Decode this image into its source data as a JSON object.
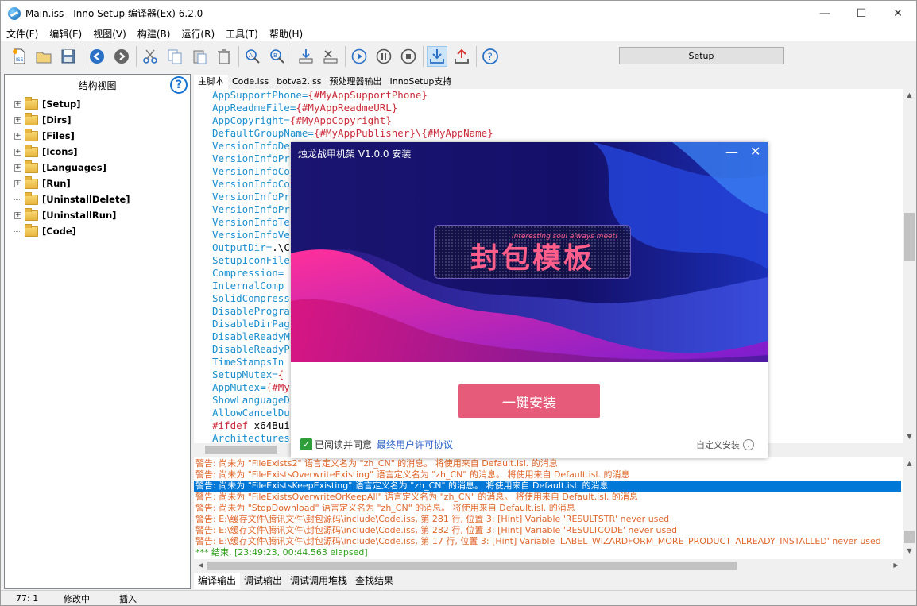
{
  "window": {
    "title": "Main.iss - Inno Setup 编译器(Ex) 6.2.0",
    "min": "—",
    "max": "☐",
    "close": "✕"
  },
  "menu": [
    "文件(F)",
    "编辑(E)",
    "视图(V)",
    "构建(B)",
    "运行(R)",
    "工具(T)",
    "帮助(H)"
  ],
  "toolbar": {
    "setup_label": "Setup"
  },
  "tree": {
    "header": "结构视图",
    "help": "?",
    "items": [
      {
        "label": "[Setup]",
        "expand": "+"
      },
      {
        "label": "[Dirs]",
        "expand": "+"
      },
      {
        "label": "[Files]",
        "expand": "+"
      },
      {
        "label": "[Icons]",
        "expand": "+"
      },
      {
        "label": "[Languages]",
        "expand": "+"
      },
      {
        "label": "[Run]",
        "expand": "+"
      },
      {
        "label": "[UninstallDelete]",
        "expand": ""
      },
      {
        "label": "[UninstallRun]",
        "expand": "+"
      },
      {
        "label": "[Code]",
        "expand": ""
      }
    ]
  },
  "editor_tabs": [
    "主脚本",
    "Code.iss",
    "botva2.iss",
    "预处理器输出",
    "InnoSetup支持"
  ],
  "code": [
    {
      "k": "AppSupportPhone=",
      "v": "{#MyAppSupportPhone}"
    },
    {
      "k": "AppReadmeFile=",
      "v": "{#MyAppReadmeURL}"
    },
    {
      "k": "AppCopyright=",
      "v": "{#MyAppCopyright}"
    },
    {
      "k": "DefaultGroupName=",
      "v": "{#MyAppPublisher}\\{#MyAppName}"
    },
    {
      "k": "VersionInfoDe",
      "v": ""
    },
    {
      "k": "VersionInfoPr",
      "v": ""
    },
    {
      "k": "VersionInfoCo",
      "v": ""
    },
    {
      "k": "VersionInfoCo",
      "v": ""
    },
    {
      "k": "VersionInfoPr",
      "v": ""
    },
    {
      "k": "VersionInfoPr",
      "v": ""
    },
    {
      "k": "VersionInfoTe",
      "v": ""
    },
    {
      "k": "VersionInfoVe",
      "v": ""
    },
    {
      "k": "OutputDir=",
      "v": ".\\C"
    },
    {
      "k": "SetupIconFile",
      "v": ""
    },
    {
      "k": "Compression=",
      "v": ""
    },
    {
      "k": "InternalComp",
      "v": ""
    },
    {
      "k": "SolidCompress",
      "v": ""
    },
    {
      "k": "DisableProgra",
      "v": ""
    },
    {
      "k": "DisableDirPag",
      "v": ""
    },
    {
      "k": "DisableReadyM",
      "v": ""
    },
    {
      "k": "DisableReadyP",
      "v": ""
    },
    {
      "k": "TimeStampsIn",
      "v": ""
    },
    {
      "k": "SetupMutex=",
      "v": "{"
    },
    {
      "k": "AppMutex=",
      "v": "{#My"
    },
    {
      "k": "ShowLanguageD",
      "v": ""
    },
    {
      "k": "AllowCancelDu",
      "v": ""
    },
    {
      "k": "#ifdef",
      "v": " x64Bui"
    },
    {
      "k": "Architectures",
      "v": ""
    }
  ],
  "output": [
    "警告: 尚未为 \"FileExists2\" 语言定义名为 \"zh_CN\" 的消息。 将使用来自 Default.isl. 的消息",
    "警告: 尚未为 \"FileExistsOverwriteExisting\" 语言定义名为 \"zh_CN\" 的消息。 将使用来自 Default.isl. 的消息",
    "警告: 尚未为 \"FileExistsKeepExisting\" 语言定义名为 \"zh_CN\" 的消息。 将使用来自 Default.isl. 的消息",
    "警告: 尚未为 \"FileExistsOverwriteOrKeepAll\" 语言定义名为 \"zh_CN\" 的消息。 将使用来自 Default.isl. 的消息",
    "警告: 尚未为 \"StopDownload\" 语言定义名为 \"zh_CN\" 的消息。 将使用来自 Default.isl. 的消息",
    "警告: E:\\缓存文件\\腾讯文件\\封包源码\\include\\Code.iss, 第 281 行, 位置 3: [Hint] Variable 'RESULTSTR' never used",
    "警告: E:\\缓存文件\\腾讯文件\\封包源码\\include\\Code.iss, 第 282 行, 位置 3: [Hint] Variable 'RESULTCODE' never used",
    "警告: E:\\缓存文件\\腾讯文件\\封包源码\\include\\Code.iss, 第 17 行, 位置 3: [Hint] Variable 'LABEL_WIZARDFORM_MORE_PRODUCT_ALREADY_INSTALLED' never used",
    "*** 结束. [23:49:23, 00:44.563 elapsed]"
  ],
  "output_tabs": [
    "编译输出",
    "调试输出",
    "调试调用堆栈",
    "查找结果"
  ],
  "status": {
    "pos": "77:   1",
    "mode": "修改中",
    "insert": "插入"
  },
  "dialog": {
    "title": "烛龙战甲机架 V1.0.0 安装",
    "min": "—",
    "close": "✕",
    "logo_text": "封包模板",
    "logo_sub": "Interesting soul always meet!",
    "install_label": "一键安装",
    "agree_label": "已阅读并同意",
    "eula_label": "最终用户许可协议",
    "custom_label": "自定义安装",
    "check": "✓",
    "chevron": "⌄"
  },
  "colors": {
    "accent": "#0078d7",
    "install": "#e65a7a",
    "warn": "#e0662a",
    "ok": "#2ea11c"
  }
}
